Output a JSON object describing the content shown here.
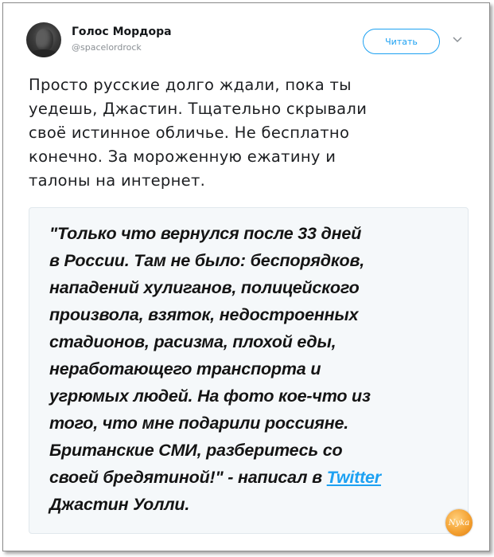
{
  "account": {
    "name": "Голос Мордора",
    "handle": "@spacelordrock"
  },
  "actions": {
    "follow_label": "Читать",
    "more_icon": "chevron-down-icon"
  },
  "tweet": {
    "lines": [
      "Просто русские долго ждали, пока ты",
      "уедешь, Джастин. Тщательно скрывали",
      "своё истинное обличье. Не бесплатно",
      "конечно. За мороженную ежатину и",
      "талоны на интернет."
    ]
  },
  "quote": {
    "lines": [
      "\"Только что вернулся после 33 дней",
      "в России. Там не было: беспорядков,",
      "нападений хулиганов, полицейского",
      "произвола, взяток, недостроенных",
      "стадионов, расизма, плохой еды,",
      "неработающего транспорта и",
      "угрюмых людей. На фото кое-что из",
      "того, что мне подарили россияне.",
      "Британские СМИ, разберитесь со"
    ],
    "line10_prefix": "своей бредятиной!\" - написал в ",
    "link_text": "Twitter",
    "last_line": "Джастин Уолли."
  },
  "watermark": {
    "text": "Nyka"
  },
  "colors": {
    "accent": "#1da1f2",
    "card_bg": "#f5f8fa",
    "watermark": "#f4a233"
  }
}
